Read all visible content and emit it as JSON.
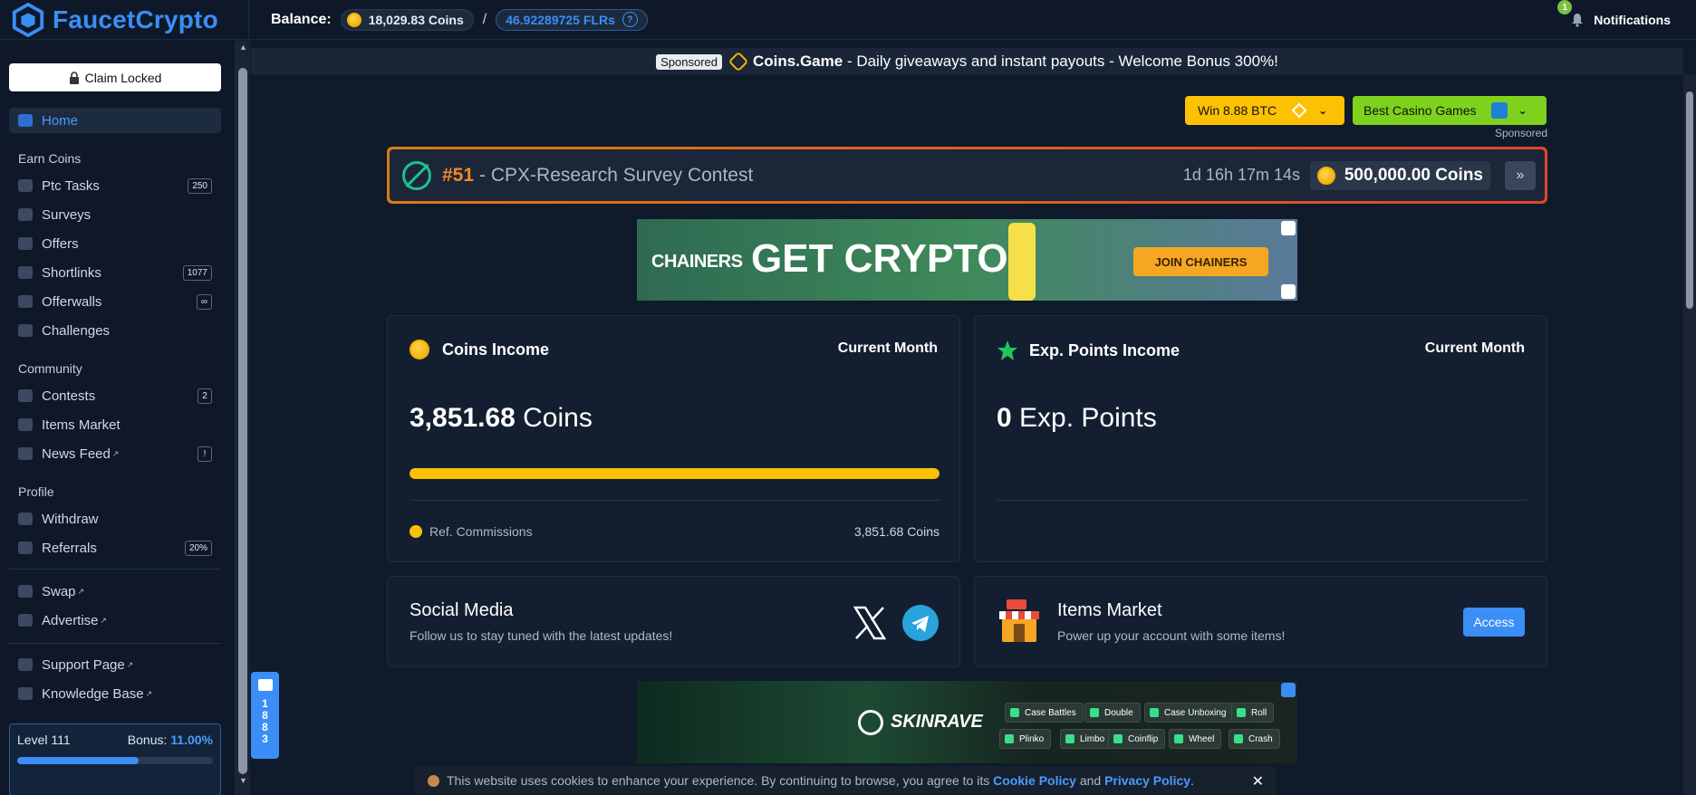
{
  "brand": {
    "name": "FaucetCrypto"
  },
  "header": {
    "balance_label": "Balance:",
    "coins": "18,029.83 Coins",
    "separator": "/",
    "flr": "46.92289725 FLRs",
    "help_glyph": "?",
    "notifications_label": "Notifications",
    "notifications_count": "1"
  },
  "sidebar": {
    "claim_label": "Claim Locked",
    "home": "Home",
    "sections": {
      "earn": "Earn Coins",
      "community": "Community",
      "profile": "Profile"
    },
    "items": {
      "ptc": {
        "label": "Ptc Tasks",
        "badge": "250"
      },
      "surveys": {
        "label": "Surveys"
      },
      "offers": {
        "label": "Offers"
      },
      "shortlinks": {
        "label": "Shortlinks",
        "badge": "1077"
      },
      "offerwalls": {
        "label": "Offerwalls",
        "badge": "∞"
      },
      "challenges": {
        "label": "Challenges"
      },
      "contests": {
        "label": "Contests",
        "badge": "2"
      },
      "items_market": {
        "label": "Items Market"
      },
      "news_feed": {
        "label": "News Feed",
        "badge": "!"
      },
      "withdraw": {
        "label": "Withdraw"
      },
      "referrals": {
        "label": "Referrals",
        "badge": "20%"
      },
      "swap": {
        "label": "Swap"
      },
      "advertise": {
        "label": "Advertise"
      },
      "support": {
        "label": "Support Page"
      },
      "knowledge": {
        "label": "Knowledge Base"
      }
    },
    "level": {
      "label": "Level 111",
      "bonus_label": "Bonus:",
      "bonus_value": "11.00%",
      "progress": 0.62
    }
  },
  "chat": {
    "count": "1883"
  },
  "sponsored_bar": {
    "tag": "Sponsored",
    "brand": "Coins.Game",
    "text": " - Daily giveaways and instant payouts - Welcome Bonus 300%!"
  },
  "promo_buttons": {
    "win": "Win 8.88 BTC",
    "casino": "Best Casino Games",
    "sponsored": "Sponsored"
  },
  "contest": {
    "number": "#51",
    "title": "- CPX-Research Survey Contest",
    "timer": "1d 16h 17m 14s",
    "prize": "500,000.00 Coins",
    "go_glyph": "»"
  },
  "ad1": {
    "brand": "CHAINERS",
    "headline": "GET CRYPTO",
    "cta": "JOIN CHAINERS"
  },
  "ad2": {
    "brand": "SKINRAVE",
    "chips": [
      "Case Battles",
      "Double",
      "Case Unboxing",
      "Roll",
      "Plinko",
      "Limbo",
      "Coinflip",
      "Wheel",
      "Crash"
    ]
  },
  "coins_income": {
    "title": "Coins Income",
    "period": "Current Month",
    "amount": "3,851.68",
    "unit": " Coins",
    "progress": 1.0,
    "ref_label": "Ref. Commissions",
    "ref_value": "3,851.68 Coins"
  },
  "exp_income": {
    "title": "Exp. Points Income",
    "period": "Current Month",
    "amount": "0",
    "unit": " Exp. Points"
  },
  "social": {
    "title": "Social Media",
    "subtitle": "Follow us to stay tuned with the latest updates!"
  },
  "items_market": {
    "title": "Items Market",
    "subtitle": "Power up your account with some items!",
    "button": "Access"
  },
  "cookie": {
    "text": "This website uses cookies to enhance your experience. By continuing to browse, you agree to its",
    "cookie_policy": "Cookie Policy",
    "and": "and",
    "privacy_policy": "Privacy Policy",
    "period": ".",
    "close": "✕"
  },
  "colors": {
    "accent": "#3a8ef6",
    "gold": "#fbc102",
    "green": "#7ed11c",
    "orange": "#f08a22"
  }
}
